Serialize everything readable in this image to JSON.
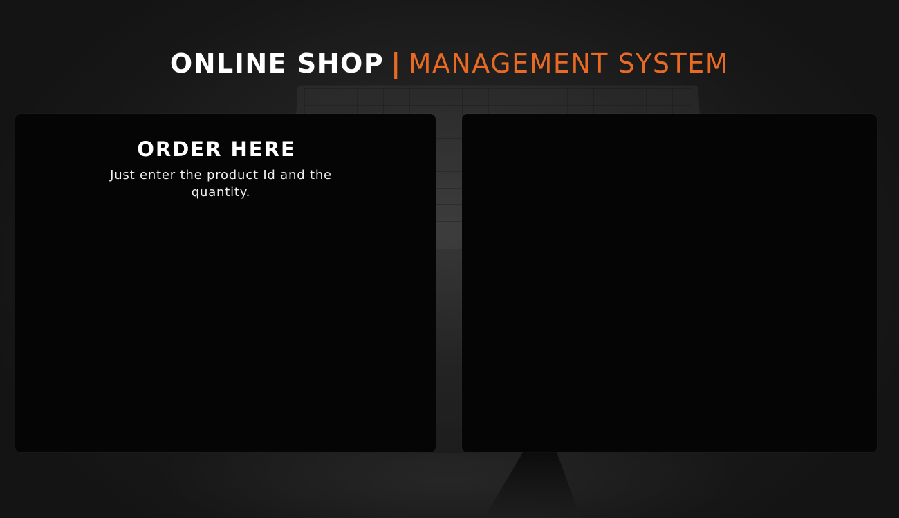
{
  "header": {
    "title_bold": "ONLINE SHOP",
    "title_separator": "|",
    "title_light": "MANAGEMENT SYSTEM"
  },
  "order_panel": {
    "heading": "ORDER HERE",
    "description": "Just enter the product Id and the quantity."
  },
  "colors": {
    "accent": "#e86a24",
    "panel_background": "#050505",
    "page_background": "#161616",
    "text": "#ffffff"
  }
}
